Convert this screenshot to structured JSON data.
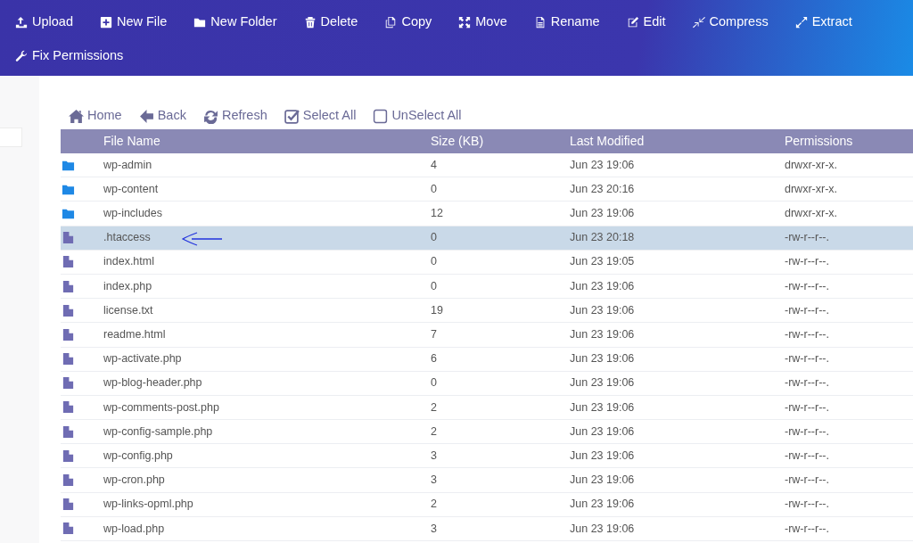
{
  "toolbar": [
    {
      "kind": "upload",
      "label": "Upload"
    },
    {
      "kind": "new-file",
      "label": "New File"
    },
    {
      "kind": "new-folder",
      "label": "New Folder"
    },
    {
      "kind": "delete",
      "label": "Delete"
    },
    {
      "kind": "copy",
      "label": "Copy"
    },
    {
      "kind": "move",
      "label": "Move"
    },
    {
      "kind": "rename",
      "label": "Rename"
    },
    {
      "kind": "edit",
      "label": "Edit"
    },
    {
      "kind": "compress",
      "label": "Compress"
    },
    {
      "kind": "extract",
      "label": "Extract"
    },
    {
      "kind": "wrench",
      "label": "Fix Permissions"
    }
  ],
  "nav": [
    {
      "kind": "home",
      "label": "Home"
    },
    {
      "kind": "back",
      "label": "Back"
    },
    {
      "kind": "refresh",
      "label": "Refresh"
    },
    {
      "kind": "checked",
      "label": "Select All"
    },
    {
      "kind": "unchecked",
      "label": "UnSelect All"
    }
  ],
  "table": {
    "columns": [
      "File Name",
      "Size (KB)",
      "Last Modified",
      "Permissions"
    ],
    "rows": [
      {
        "kind": "folder",
        "name": "wp-admin",
        "size": "4",
        "modified": "Jun 23 19:06",
        "permissions": "drwxr-xr-x.",
        "selected": false
      },
      {
        "kind": "folder",
        "name": "wp-content",
        "size": "0",
        "modified": "Jun 23 20:16",
        "permissions": "drwxr-xr-x.",
        "selected": false
      },
      {
        "kind": "folder",
        "name": "wp-includes",
        "size": "12",
        "modified": "Jun 23 19:06",
        "permissions": "drwxr-xr-x.",
        "selected": false
      },
      {
        "kind": "file",
        "name": ".htaccess",
        "size": "0",
        "modified": "Jun 23 20:18",
        "permissions": "-rw-r--r--.",
        "selected": true
      },
      {
        "kind": "file",
        "name": "index.html",
        "size": "0",
        "modified": "Jun 23 19:05",
        "permissions": "-rw-r--r--.",
        "selected": false
      },
      {
        "kind": "file",
        "name": "index.php",
        "size": "0",
        "modified": "Jun 23 19:06",
        "permissions": "-rw-r--r--.",
        "selected": false
      },
      {
        "kind": "file",
        "name": "license.txt",
        "size": "19",
        "modified": "Jun 23 19:06",
        "permissions": "-rw-r--r--.",
        "selected": false
      },
      {
        "kind": "file",
        "name": "readme.html",
        "size": "7",
        "modified": "Jun 23 19:06",
        "permissions": "-rw-r--r--.",
        "selected": false
      },
      {
        "kind": "file",
        "name": "wp-activate.php",
        "size": "6",
        "modified": "Jun 23 19:06",
        "permissions": "-rw-r--r--.",
        "selected": false
      },
      {
        "kind": "file",
        "name": "wp-blog-header.php",
        "size": "0",
        "modified": "Jun 23 19:06",
        "permissions": "-rw-r--r--.",
        "selected": false
      },
      {
        "kind": "file",
        "name": "wp-comments-post.php",
        "size": "2",
        "modified": "Jun 23 19:06",
        "permissions": "-rw-r--r--.",
        "selected": false
      },
      {
        "kind": "file",
        "name": "wp-config-sample.php",
        "size": "2",
        "modified": "Jun 23 19:06",
        "permissions": "-rw-r--r--.",
        "selected": false
      },
      {
        "kind": "file",
        "name": "wp-config.php",
        "size": "3",
        "modified": "Jun 23 19:06",
        "permissions": "-rw-r--r--.",
        "selected": false
      },
      {
        "kind": "file",
        "name": "wp-cron.php",
        "size": "3",
        "modified": "Jun 23 19:06",
        "permissions": "-rw-r--r--.",
        "selected": false
      },
      {
        "kind": "file",
        "name": "wp-links-opml.php",
        "size": "2",
        "modified": "Jun 23 19:06",
        "permissions": "-rw-r--r--.",
        "selected": false
      },
      {
        "kind": "file",
        "name": "wp-load.php",
        "size": "3",
        "modified": "Jun 23 19:06",
        "permissions": "-rw-r--r--.",
        "selected": false
      }
    ]
  }
}
